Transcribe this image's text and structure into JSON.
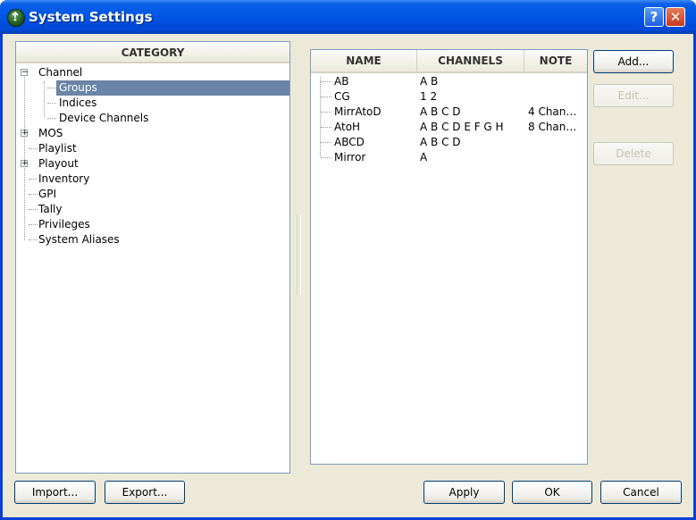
{
  "window": {
    "title": "System Settings",
    "help_label": "?",
    "close_label": "✕"
  },
  "category": {
    "header": "CATEGORY",
    "tree": [
      {
        "label": "Channel",
        "expander": "−"
      },
      {
        "label": "Groups"
      },
      {
        "label": "Indices"
      },
      {
        "label": "Device Channels"
      },
      {
        "label": "MOS",
        "expander": "+"
      },
      {
        "label": "Playlist"
      },
      {
        "label": "Playout",
        "expander": "+"
      },
      {
        "label": "Inventory"
      },
      {
        "label": "GPI"
      },
      {
        "label": "Tally"
      },
      {
        "label": "Privileges"
      },
      {
        "label": "System Aliases"
      }
    ]
  },
  "groups": {
    "columns": [
      "NAME",
      "CHANNELS",
      "NOTE"
    ],
    "rows": [
      {
        "name": "AB",
        "channels": "A B",
        "note": ""
      },
      {
        "name": "CG",
        "channels": "1 2",
        "note": ""
      },
      {
        "name": "MirrAtoD",
        "channels": "A B C D",
        "note": "4 Chan…"
      },
      {
        "name": "AtoH",
        "channels": "A B C D E F G H",
        "note": "8 Chan…"
      },
      {
        "name": "ABCD",
        "channels": "A B C D",
        "note": ""
      },
      {
        "name": "Mirror",
        "channels": "A",
        "note": ""
      }
    ]
  },
  "side_buttons": {
    "add": "Add...",
    "edit": "Edit...",
    "delete": "Delete"
  },
  "footer": {
    "import": "Import...",
    "export": "Export...",
    "apply": "Apply",
    "ok": "OK",
    "cancel": "Cancel"
  },
  "colors": {
    "titlebar": "#0055e5",
    "selection": "#6b84a6",
    "dialog_bg": "#ece9d8"
  }
}
